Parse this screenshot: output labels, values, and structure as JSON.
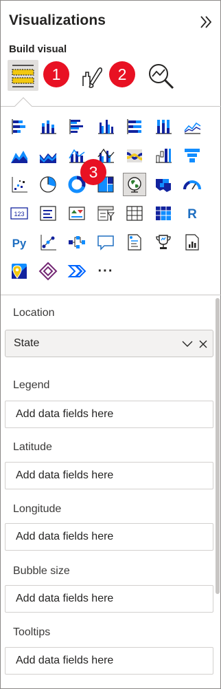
{
  "header": {
    "title": "Visualizations",
    "collapse_icon": "double-chevron-right-icon",
    "build_label": "Build visual"
  },
  "modes": [
    {
      "name": "build-visual",
      "icon": "build-visual-icon",
      "active": true
    },
    {
      "name": "format-visual",
      "icon": "paintbrush-icon",
      "active": false
    },
    {
      "name": "analytics",
      "icon": "analytics-magnifier-icon",
      "active": false
    }
  ],
  "badges": [
    "1",
    "2",
    "3"
  ],
  "visual_icons": [
    "stacked-bar-chart-icon",
    "stacked-column-chart-icon",
    "clustered-bar-chart-icon",
    "clustered-column-chart-icon",
    "100-percent-stacked-bar-icon",
    "100-percent-stacked-column-icon",
    "line-chart-icon",
    "area-chart-icon",
    "stacked-area-chart-icon",
    "line-and-stacked-column-icon",
    "line-and-clustered-column-icon",
    "ribbon-chart-icon",
    "waterfall-chart-icon",
    "funnel-chart-icon",
    "scatter-chart-icon",
    "pie-chart-icon",
    "donut-chart-icon",
    "treemap-icon",
    "map-icon",
    "filled-map-icon",
    "gauge-icon",
    "card-icon",
    "multi-row-card-icon",
    "kpi-icon",
    "slicer-icon",
    "table-icon",
    "matrix-icon",
    "r-script-visual-icon",
    "python-visual-icon",
    "key-influencers-icon",
    "decomposition-tree-icon",
    "qa-icon",
    "smart-narrative-icon",
    "metrics-trophy-icon",
    "paginated-report-icon",
    "azure-map-icon",
    "power-apps-icon",
    "power-automate-icon",
    "more-visuals-icon"
  ],
  "selected_visual": "map-icon",
  "fields": {
    "location": {
      "label": "Location",
      "value": "State"
    },
    "legend": {
      "label": "Legend",
      "placeholder": "Add data fields here"
    },
    "latitude": {
      "label": "Latitude",
      "placeholder": "Add data fields here"
    },
    "longitude": {
      "label": "Longitude",
      "placeholder": "Add data fields here"
    },
    "bubble_size": {
      "label": "Bubble size",
      "placeholder": "Add data fields here"
    },
    "tooltips": {
      "label": "Tooltips",
      "placeholder": "Add data fields here"
    }
  },
  "colors": {
    "accent_blue": "#118dff",
    "dark_blue": "#12239e",
    "accent_yellow": "#f2c811",
    "badge_red": "#e81123",
    "selected_bg": "#e1dfdd"
  }
}
